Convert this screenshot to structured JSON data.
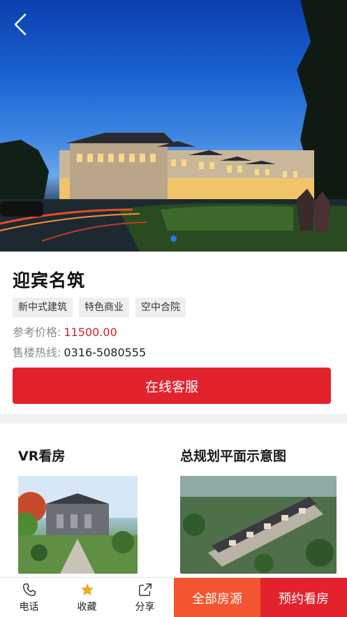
{
  "hero": {
    "slide_count": 1,
    "active_slide": 1
  },
  "project": {
    "name": "迎宾名筑",
    "tags": [
      "新中式建筑",
      "特色商业",
      "空中合院"
    ],
    "price_label": "参考价格:",
    "price_value": "11500.00",
    "phone_label": "售楼热线:",
    "phone_value": "0316-5080555"
  },
  "customer_service_label": "在线客服",
  "sections": {
    "vr_title": "VR看房",
    "plan_title": "总规划平面示意图"
  },
  "bottom_bar": {
    "phone_label": "电话",
    "favorite_label": "收藏",
    "share_label": "分享",
    "all_listings_label": "全部房源",
    "book_viewing_label": "预约看房"
  },
  "colors": {
    "accent_red": "#e2232e",
    "accent_orange": "#f2552f",
    "price_red": "#d31f2c",
    "favorite_star": "#f5a623",
    "carousel_dot": "#1e7cf0"
  },
  "icons": {
    "back": "back-arrow-icon",
    "phone": "phone-icon",
    "favorite": "star-icon",
    "share": "share-icon"
  }
}
